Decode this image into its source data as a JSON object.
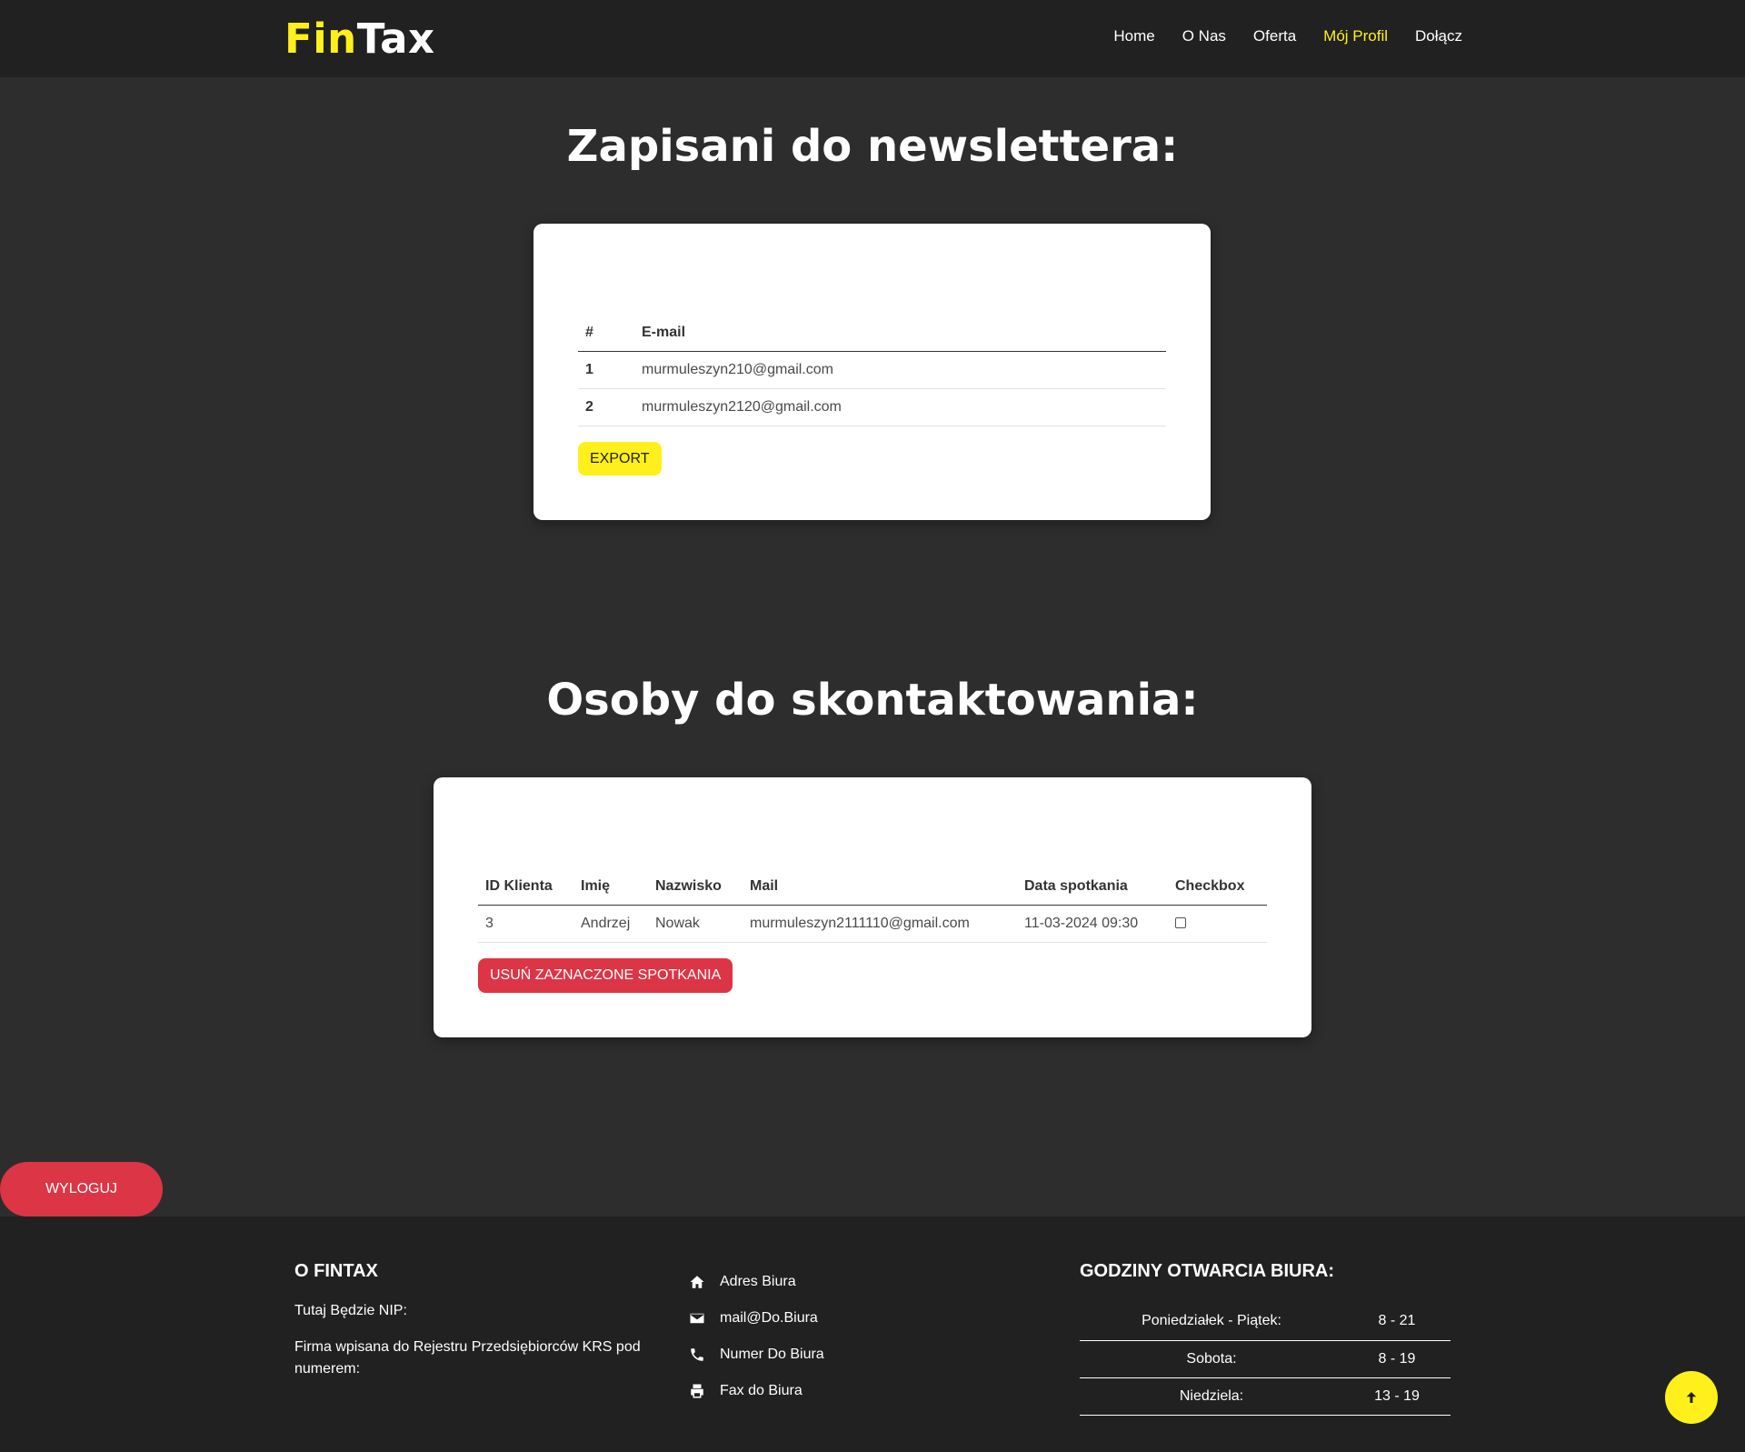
{
  "brand": {
    "part1": "Fin",
    "part2": "Tax"
  },
  "nav": {
    "items": [
      "Home",
      "O Nas",
      "Oferta",
      "Mój Profil",
      "Dołącz"
    ],
    "active": "Mój Profil"
  },
  "newsletter": {
    "title": "Zapisani do newslettera:",
    "headers": [
      "#",
      "E-mail"
    ],
    "rows": [
      {
        "num": "1",
        "email": "murmuleszyn210@gmail.com"
      },
      {
        "num": "2",
        "email": "murmuleszyn2120@gmail.com"
      }
    ],
    "export_label": "EXPORT"
  },
  "contacts": {
    "title": "Osoby do skontaktowania:",
    "headers": [
      "ID Klienta",
      "Imię",
      "Nazwisko",
      "Mail",
      "Data spotkania",
      "Checkbox"
    ],
    "rows": [
      {
        "id": "3",
        "first": "Andrzej",
        "last": "Nowak",
        "mail": "murmuleszyn2111110@gmail.com",
        "date": "11-03-2024 09:30",
        "checked": false
      }
    ],
    "delete_label": "USUŃ ZAZNACZONE SPOTKANIA"
  },
  "logout_label": "WYLOGUJ",
  "footer": {
    "about_title": "O FINTAX",
    "nip_text": "Tutaj Będzie NIP:",
    "krs_text": "Firma wpisana do Rejestru Przedsiębiorców KRS pod numerem:",
    "contact": [
      {
        "icon": "home-icon",
        "label": "Adres Biura"
      },
      {
        "icon": "envelope-icon",
        "label": "mail@Do.Biura"
      },
      {
        "icon": "phone-icon",
        "label": "Numer Do Biura"
      },
      {
        "icon": "printer-icon",
        "label": "Fax do Biura"
      }
    ],
    "hours_title": "GODZINY OTWARCIA BIURA:",
    "hours": [
      {
        "day": "Poniedziałek - Piątek:",
        "time": "8 - 21"
      },
      {
        "day": "Sobota:",
        "time": "8 - 19"
      },
      {
        "day": "Niedziela:",
        "time": "13 - 19"
      }
    ]
  },
  "colors": {
    "accent": "#fff01c",
    "danger": "#dc3545",
    "background": "#2e2d2d",
    "nav_bg": "#212121"
  }
}
